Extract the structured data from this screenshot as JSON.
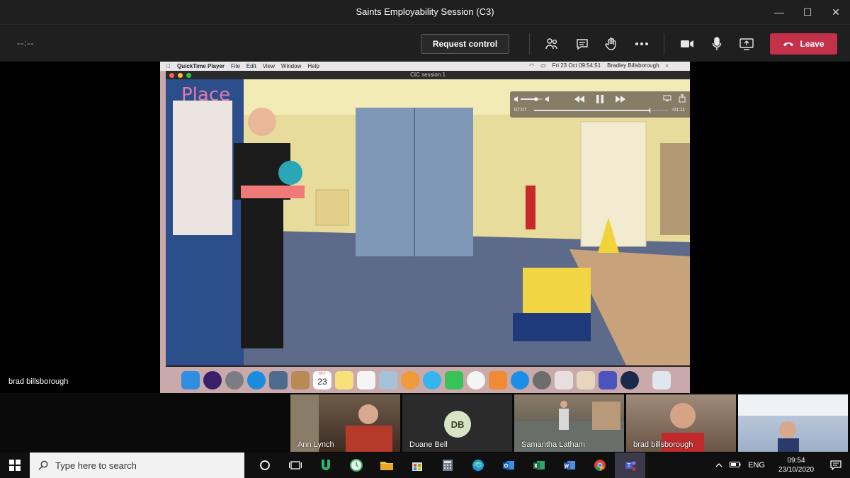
{
  "window": {
    "title": "Saints Employability Session (C3)",
    "minimize": "—",
    "maximize": "☐",
    "close": "✕"
  },
  "toolbar": {
    "timer": "--:--",
    "request_control": "Request control",
    "leave": "Leave"
  },
  "stage": {
    "presenter_name": "brad billsborough"
  },
  "mac": {
    "app_name": "QuickTime Player",
    "menus": [
      "File",
      "Edit",
      "View",
      "Window",
      "Help"
    ],
    "clock": "Fri 23 Oct  09:54:51",
    "user": "Bradley Billsborough",
    "window_title": "CIC session 1",
    "elapsed": "07:07",
    "remaining": "-01:11",
    "playback_progress": 0.86,
    "volume_level": 0.7,
    "calendar_day": "23",
    "calendar_month": "OCT"
  },
  "participants": [
    {
      "name": "Ann Lynch"
    },
    {
      "name": "Duane Bell",
      "initials": "DB"
    },
    {
      "name": "Samantha Latham"
    },
    {
      "name": "brad billsborough"
    },
    {
      "name": ""
    }
  ],
  "taskbar": {
    "search_placeholder": "Type here to search",
    "lang": "ENG",
    "time": "09:54",
    "date": "23/10/2020"
  },
  "colors": {
    "leave": "#c4314b",
    "titlebar": "#1f1f1f",
    "taskbar": "#101010",
    "avatar_bg": "#d8e4c5"
  }
}
